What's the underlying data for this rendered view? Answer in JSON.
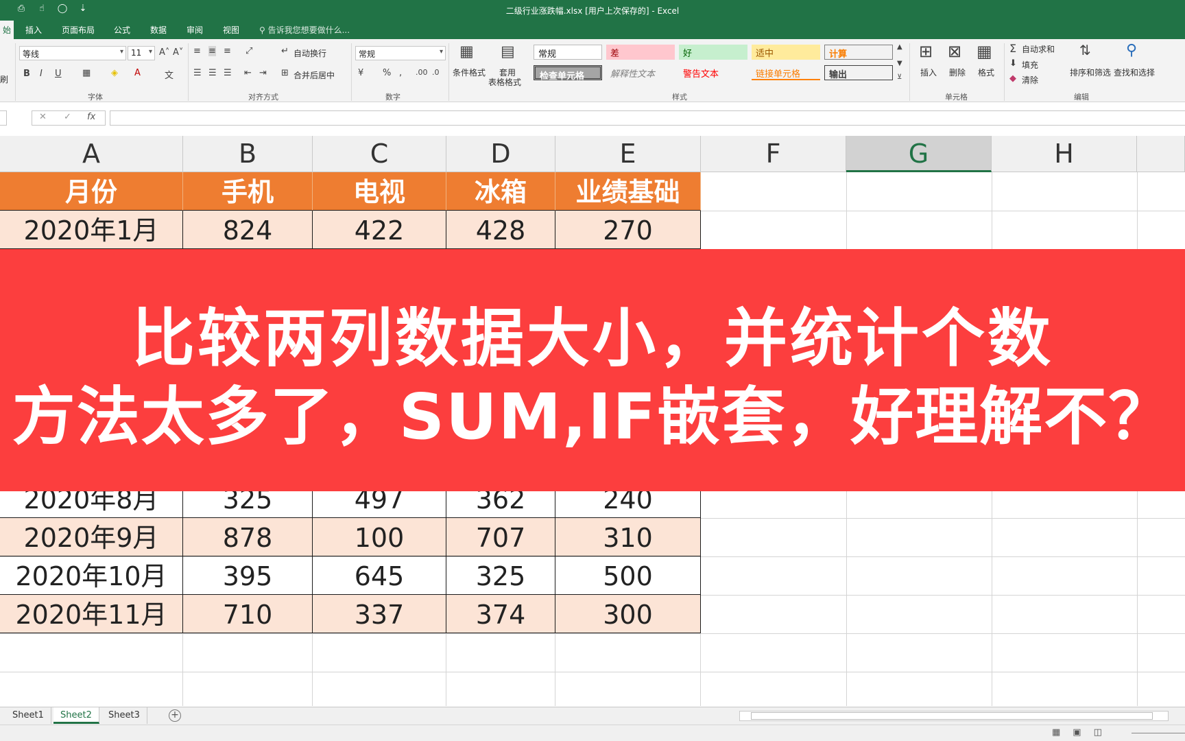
{
  "window": {
    "title": "二级行业涨跌幅.xlsx [用户上次保存的] - Excel"
  },
  "ribbon_tabs": [
    "始",
    "插入",
    "页面布局",
    "公式",
    "数据",
    "审阅",
    "视图"
  ],
  "tell_me": "告诉我您想要做什么...",
  "font": {
    "name": "等线",
    "size": "11",
    "group_label": "字体"
  },
  "alignment": {
    "wrap": "自动换行",
    "merge": "合并后居中",
    "group_label": "对齐方式"
  },
  "number": {
    "format": "常规",
    "group_label": "数字"
  },
  "styles": {
    "conditional": "条件格式",
    "table_format_1": "套用",
    "table_format_2": "表格格式",
    "cells": [
      "常规",
      "差",
      "好",
      "适中",
      "计算",
      "检查单元格",
      "解释性文本",
      "警告文本",
      "链接单元格",
      "输出"
    ],
    "group_label": "样式"
  },
  "cells_group": {
    "insert": "插入",
    "delete": "删除",
    "format": "格式",
    "group_label": "单元格"
  },
  "editing": {
    "autosum": "自动求和",
    "fill": "填充",
    "clear": "清除",
    "sort": "排序和筛选",
    "find": "查找和选择",
    "group_label": "编辑"
  },
  "side_label": "刷",
  "formula_bar": {
    "fx": "fx"
  },
  "columns": [
    "A",
    "B",
    "C",
    "D",
    "E",
    "F",
    "G",
    "H"
  ],
  "selected_column": "G",
  "table": {
    "headers": [
      "月份",
      "手机",
      "电视",
      "冰箱",
      "业绩基础"
    ],
    "rows_top": [
      [
        "2020年1月",
        "824",
        "422",
        "428",
        "270"
      ]
    ],
    "rows_bottom": [
      [
        "2020年8月",
        "325",
        "497",
        "362",
        "240"
      ],
      [
        "2020年9月",
        "878",
        "100",
        "707",
        "310"
      ],
      [
        "2020年10月",
        "395",
        "645",
        "325",
        "500"
      ],
      [
        "2020年11月",
        "710",
        "337",
        "374",
        "300"
      ]
    ]
  },
  "banner": {
    "line1": "比较两列数据大小，并统计个数",
    "line2": "方法太多了，SUM,IF嵌套，好理解不？"
  },
  "sheets": [
    "Sheet1",
    "Sheet2",
    "Sheet3"
  ],
  "active_sheet": "Sheet2",
  "colors": {
    "excel_green": "#217346",
    "header_orange": "#ee7d31",
    "row_pink": "#fce4d6",
    "banner_red": "#fc3e3e"
  }
}
